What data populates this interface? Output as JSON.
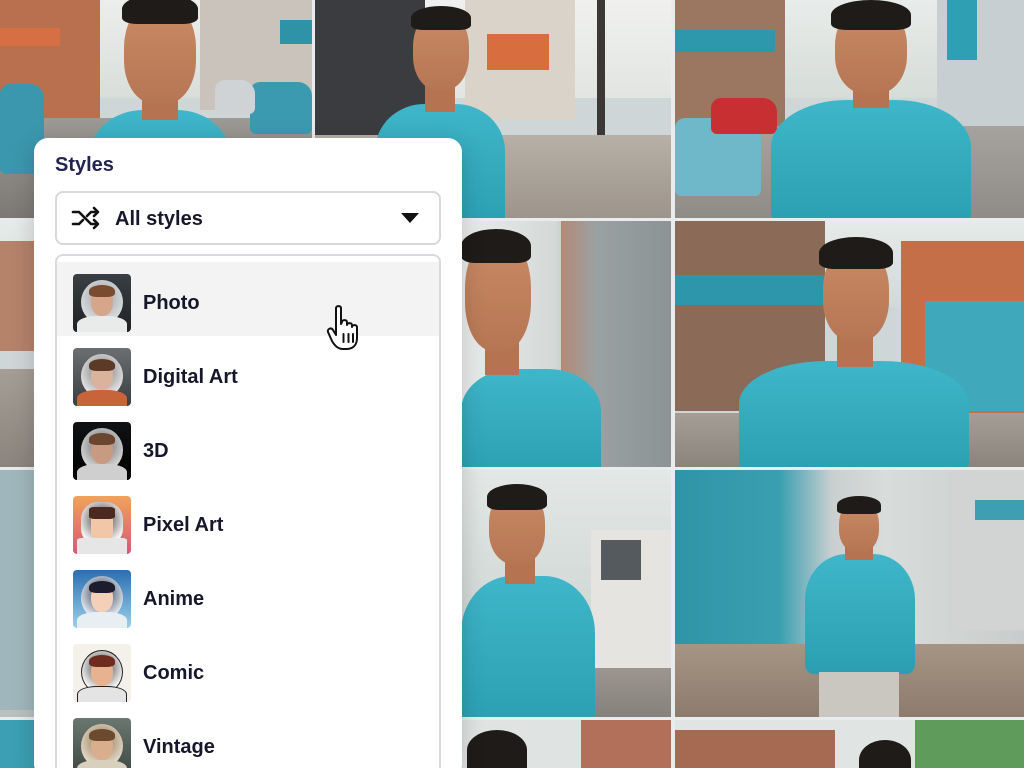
{
  "panel": {
    "title": "Styles",
    "dropdown": {
      "selected_label": "All styles",
      "icon": "shuffle-icon"
    }
  },
  "style_options": [
    {
      "label": "Photo",
      "hovered": true
    },
    {
      "label": "Digital Art",
      "hovered": false
    },
    {
      "label": "3D",
      "hovered": false
    },
    {
      "label": "Pixel Art",
      "hovered": false
    },
    {
      "label": "Anime",
      "hovered": false
    },
    {
      "label": "Comic",
      "hovered": false
    },
    {
      "label": "Vintage",
      "hovered": false
    }
  ],
  "colors": {
    "title": "#232550",
    "text": "#16172a",
    "border": "#d7d9dd",
    "hover": "#f3f3f4",
    "shirt": "#3fb6c9"
  },
  "background": {
    "description_icons": "photo-grid"
  },
  "cursor": {
    "icon": "hand-pointer-icon"
  }
}
